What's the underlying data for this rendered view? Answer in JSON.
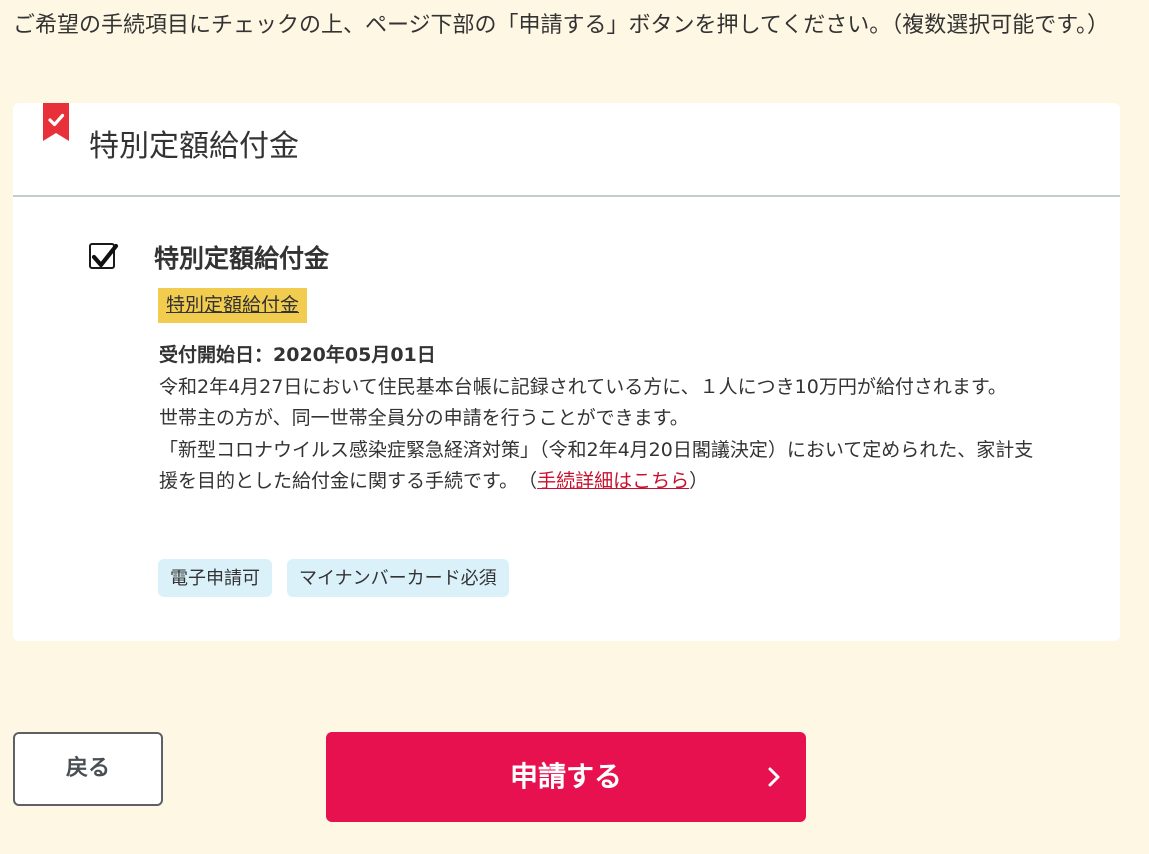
{
  "instructions": "ご希望の手続項目にチェックの上、ページ下部の「申請する」ボタンを押してください。（複数選択可能です。）",
  "section": {
    "title": "特別定額給付金",
    "item": {
      "checked": true,
      "title": "特別定額給付金",
      "category_tag": "特別定額給付金",
      "start_date": "受付開始日：2020年05月01日",
      "description_1": "令和2年4月27日において住民基本台帳に記録されている方に、１人につき10万円が給付されます。",
      "description_2": "世帯主の方が、同一世帯全員分の申請を行うことができます。",
      "description_3_prefix": "「新型コロナウイルス感染症緊急経済対策」（令和2年4月20日閣議決定）において定められた、家計支援を目的とした給付金に関する手続です。　（",
      "detail_link": "手続詳細はこちら",
      "description_3_suffix": "）",
      "tags": [
        "電子申請可",
        "マイナンバーカード必須"
      ]
    }
  },
  "buttons": {
    "back": "戻る",
    "apply": "申請する"
  },
  "colors": {
    "page_background": "#fdf7e3",
    "accent": "#e8114f",
    "bookmark": "#e8303a",
    "category_tag": "#f2cc4e",
    "feature_tag": "#daf1fa",
    "link": "#c8102e"
  },
  "icons": {
    "bookmark": "bookmark-check-icon",
    "checkbox": "check-icon",
    "apply": "chevron-right-icon"
  }
}
